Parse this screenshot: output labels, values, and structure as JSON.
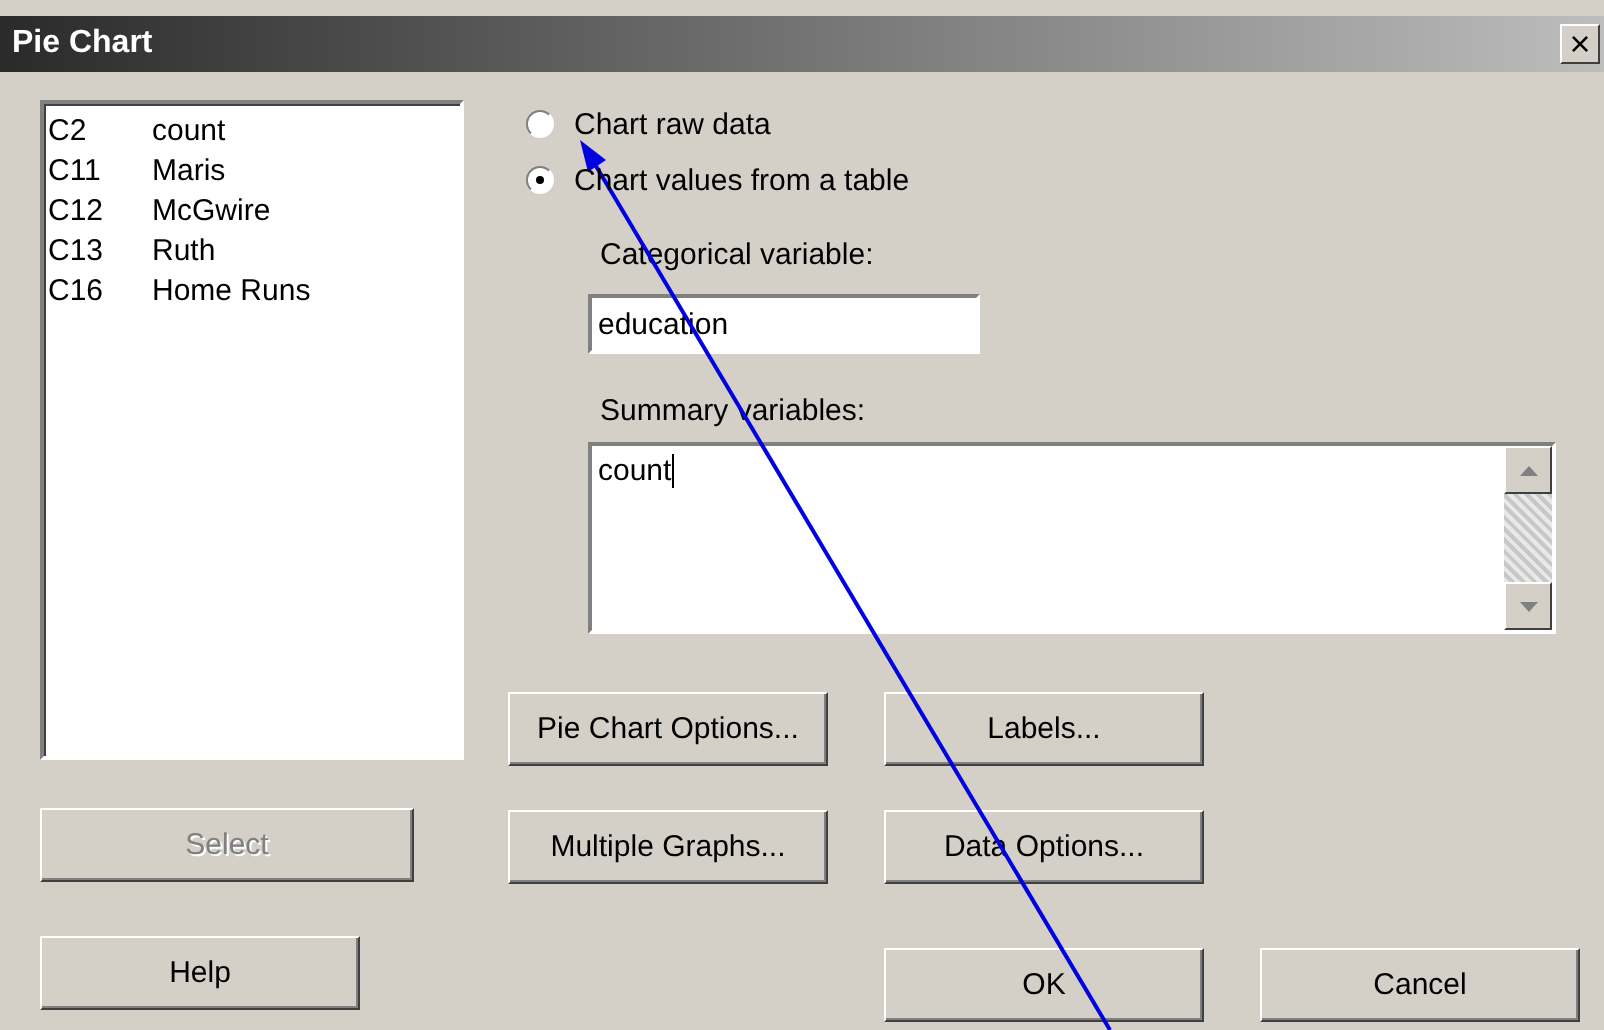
{
  "window": {
    "title": "Pie Chart",
    "close": "×"
  },
  "columns_list": [
    {
      "column": "C2",
      "name": "count"
    },
    {
      "column": "C11",
      "name": "Maris"
    },
    {
      "column": "C12",
      "name": "McGwire"
    },
    {
      "column": "C13",
      "name": "Ruth"
    },
    {
      "column": "C16",
      "name": "Home Runs"
    }
  ],
  "radios": [
    {
      "label": "Chart raw data",
      "selected": false
    },
    {
      "label": "Chart values from a table",
      "selected": true
    }
  ],
  "categorical": {
    "label": "Categorical variable:",
    "value": "education"
  },
  "summary": {
    "label": "Summary variables:",
    "value": "count"
  },
  "select_button": {
    "label": "Select",
    "disabled": true
  },
  "option_buttons": [
    "Pie Chart Options...",
    "Labels...",
    "Multiple Graphs...",
    "Data Options..."
  ],
  "help_button": "Help",
  "ok_button": "OK",
  "cancel_button": "Cancel"
}
